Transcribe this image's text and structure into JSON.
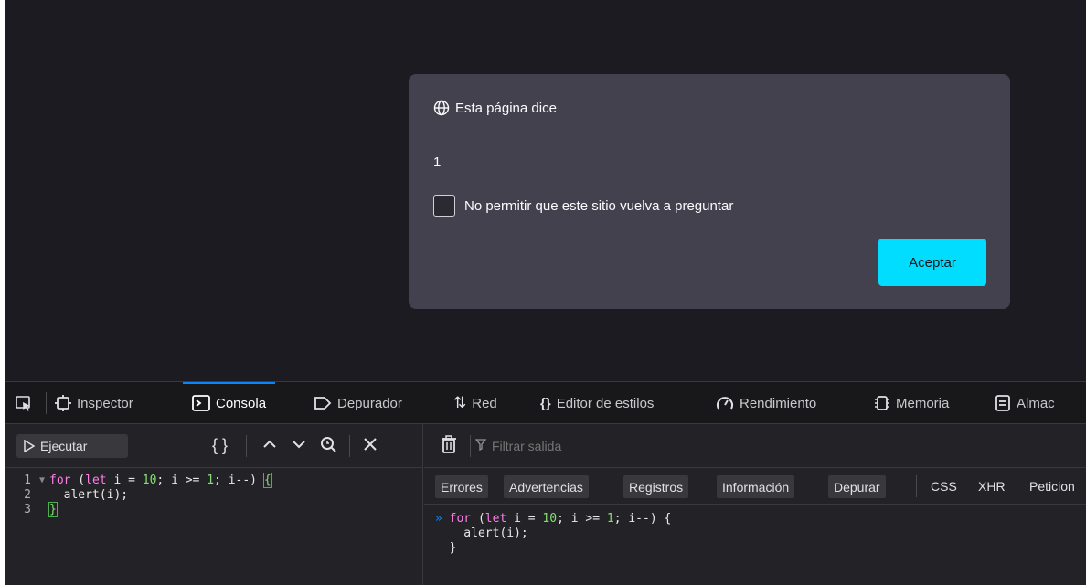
{
  "dialog": {
    "title": "Esta página dice",
    "message": "1",
    "checkbox_label": "No permitir que este sitio vuelva a preguntar",
    "accept_label": "Aceptar"
  },
  "devtools": {
    "tabs": [
      {
        "label": "Inspector",
        "icon": "inspector-icon"
      },
      {
        "label": "Consola",
        "icon": "console-icon",
        "active": true
      },
      {
        "label": "Depurador",
        "icon": "debugger-icon"
      },
      {
        "label": "Red",
        "icon": "network-icon"
      },
      {
        "label": "Editor de estilos",
        "icon": "style-editor-icon"
      },
      {
        "label": "Rendimiento",
        "icon": "performance-icon"
      },
      {
        "label": "Memoria",
        "icon": "memory-icon"
      },
      {
        "label": "Almac",
        "icon": "storage-icon"
      }
    ],
    "run_label": "Ejecutar",
    "filter_placeholder": "Filtrar salida",
    "filters": [
      "Errores",
      "Advertencias",
      "Registros",
      "Información",
      "Depurar"
    ],
    "filter_texts": [
      "CSS",
      "XHR",
      "Peticion"
    ],
    "editor_lines": [
      "1",
      "2",
      "3"
    ]
  },
  "colors": {
    "accent": "#0a84ff",
    "accept_button": "#00ddff",
    "dialog_bg": "#42414d",
    "page_bg": "#1c1b22"
  }
}
